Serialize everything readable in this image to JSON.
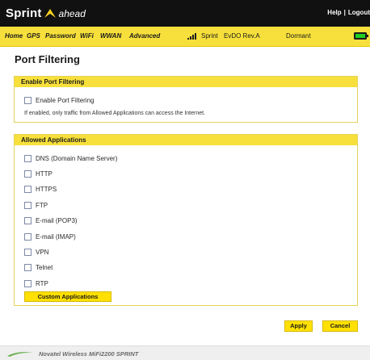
{
  "header": {
    "brand_name": "Sprint",
    "brand_tagline": "ahead",
    "help_label": "Help",
    "separator": "|",
    "logout_label": "Logout"
  },
  "nav": {
    "items": [
      {
        "label": "Home"
      },
      {
        "label": "GPS"
      },
      {
        "label": "Password"
      },
      {
        "label": "WiFi"
      },
      {
        "label": "WWAN"
      },
      {
        "label": "Advanced"
      }
    ],
    "carrier": "Sprint",
    "network": "EvDO Rev.A",
    "connection_status": "Dormant",
    "signal_icon": "signal-bars-icon",
    "battery_icon": "battery-icon"
  },
  "page": {
    "title": "Port Filtering"
  },
  "enable_section": {
    "header": "Enable Port Filtering",
    "checkbox_label": "Enable Port Filtering",
    "hint": "If enabled, only traffic from Allowed Applications can access the Internet."
  },
  "allowed_section": {
    "header": "Allowed Applications",
    "applications": [
      {
        "label": "DNS (Domain Name Server)",
        "checked": false
      },
      {
        "label": "HTTP",
        "checked": false
      },
      {
        "label": "HTTPS",
        "checked": false
      },
      {
        "label": "FTP",
        "checked": false
      },
      {
        "label": "E-mail (POP3)",
        "checked": false
      },
      {
        "label": "E-mail (IMAP)",
        "checked": false
      },
      {
        "label": "VPN",
        "checked": false
      },
      {
        "label": "Telnet",
        "checked": false
      },
      {
        "label": "RTP",
        "checked": false
      }
    ],
    "custom_button": "Custom Applications"
  },
  "actions": {
    "apply_label": "Apply",
    "cancel_label": "Cancel"
  },
  "footer": {
    "text": "Novatel Wireless MiFi2200 SPRINT"
  },
  "colors": {
    "brand_yellow": "#f7e03b",
    "topbar_black": "#111111",
    "battery_green": "#22cc22"
  }
}
